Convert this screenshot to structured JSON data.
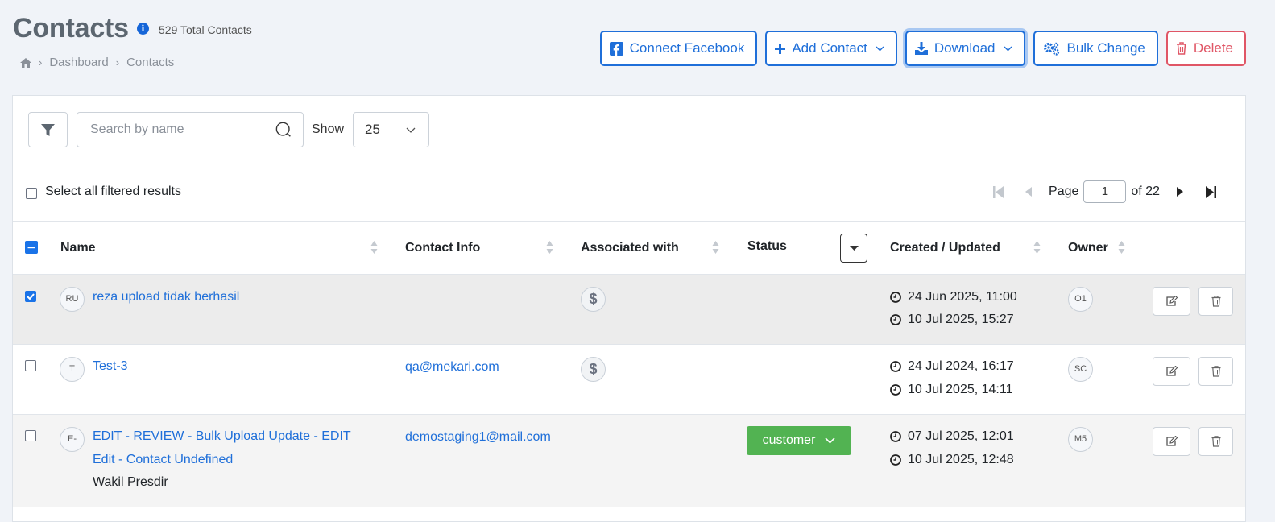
{
  "header": {
    "title": "Contacts",
    "total_contacts": "529 Total Contacts",
    "breadcrumb": [
      "Dashboard",
      "Contacts"
    ]
  },
  "actions": {
    "connect_facebook": "Connect Facebook",
    "add_contact": "Add Contact",
    "download": "Download",
    "bulk_change": "Bulk Change",
    "delete": "Delete"
  },
  "toolbar": {
    "search_placeholder": "Search by name",
    "show_label": "Show",
    "show_value": "25"
  },
  "subbar": {
    "select_all_label": "Select all filtered results",
    "page_label": "Page",
    "page_current": "1",
    "page_of": "of 22"
  },
  "table": {
    "columns": [
      "Name",
      "Contact Info",
      "Associated with",
      "Status",
      "Created / Updated",
      "Owner"
    ],
    "rows": [
      {
        "checked": true,
        "initials": "RU",
        "name": "reza upload tidak berhasil",
        "name_line2": "",
        "subtitle": "",
        "contact": "",
        "associated": "$",
        "status": "",
        "created": "24 Jun 2025, 11:00",
        "updated": "10 Jul 2025, 15:27",
        "owner": "O1"
      },
      {
        "checked": false,
        "initials": "T",
        "name": "Test-3",
        "name_line2": "",
        "subtitle": "",
        "contact": "qa@mekari.com",
        "associated": "$",
        "status": "",
        "created": "24 Jul 2024, 16:17",
        "updated": "10 Jul 2025, 14:11",
        "owner": "SC"
      },
      {
        "checked": false,
        "initials": "E-",
        "name": "EDIT - REVIEW - Bulk Upload Update - EDIT",
        "name_line2": "Edit - Contact Undefined",
        "subtitle": "Wakil Presdir",
        "contact": "demostaging1@mail.com",
        "associated": "",
        "status": "customer",
        "created": "07 Jul 2025, 12:01",
        "updated": "10 Jul 2025, 12:48",
        "owner": "M5"
      }
    ]
  },
  "colors": {
    "primary": "#1f6fd9",
    "danger": "#e05666",
    "status_customer": "#52b352"
  }
}
